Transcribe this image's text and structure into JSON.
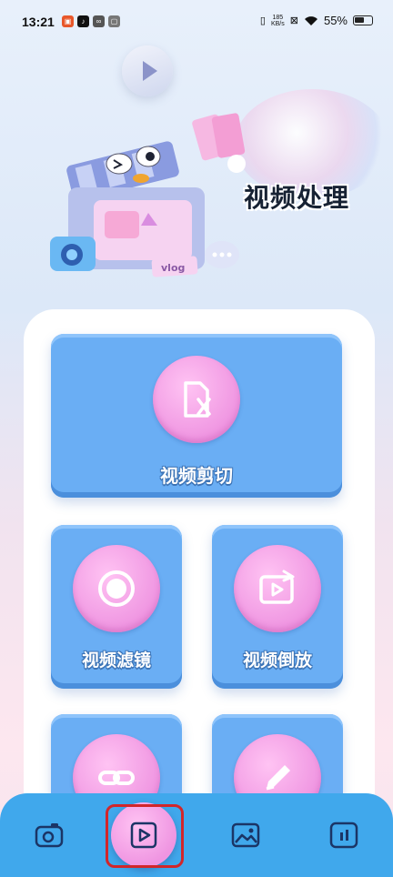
{
  "status_bar": {
    "time": "13:21",
    "net_speed_value": "185",
    "net_speed_unit": "KB/s",
    "battery_percent": "55%"
  },
  "hero": {
    "title": "视频处理",
    "sticker_vlog": "vlog"
  },
  "features": {
    "cut": {
      "label": "视频剪切",
      "icon": "cut-file-icon"
    },
    "filter": {
      "label": "视频滤镜",
      "icon": "record-circle-icon"
    },
    "reverse": {
      "label": "视频倒放",
      "icon": "reverse-play-icon"
    },
    "link": {
      "icon": "link-icon"
    },
    "edit": {
      "icon": "pencil-icon"
    }
  },
  "bottom_nav": {
    "items": [
      {
        "icon": "camera-icon",
        "active": false
      },
      {
        "icon": "play-square-icon",
        "active": true
      },
      {
        "icon": "image-icon",
        "active": false
      },
      {
        "icon": "pause-square-icon",
        "active": false
      }
    ]
  },
  "colors": {
    "card_blue": "#6aaef4",
    "circle_pink": "#ef95e1",
    "nav_blue": "#40a8ec",
    "highlight_red": "#d2262a"
  }
}
